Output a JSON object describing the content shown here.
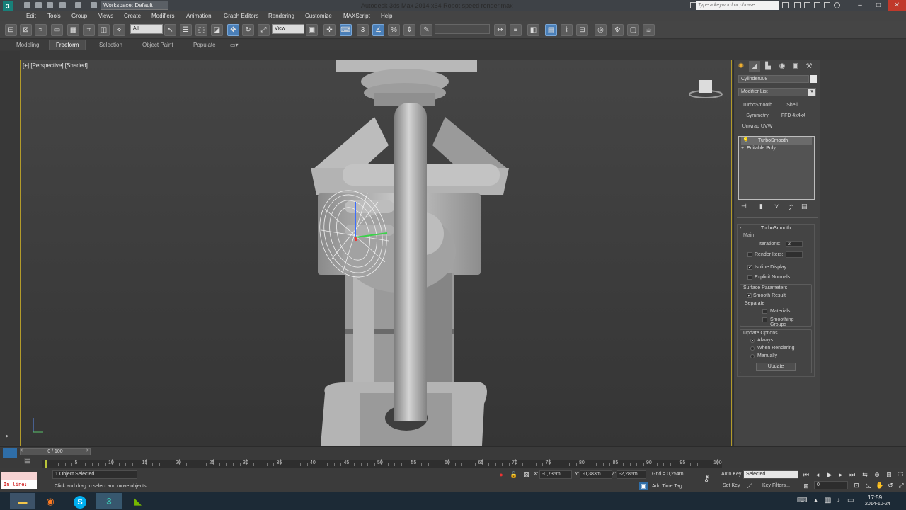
{
  "titlebar": {
    "workspace": "Workspace: Default",
    "app_title": "Autodesk 3ds Max 2014 x64     Robot speed render.max",
    "search_placeholder": "Type a keyword or phrase",
    "min": "–",
    "max": "□",
    "close": "✕"
  },
  "menu": [
    "Edit",
    "Tools",
    "Group",
    "Views",
    "Create",
    "Modifiers",
    "Animation",
    "Graph Editors",
    "Rendering",
    "Customize",
    "MAXScript",
    "Help"
  ],
  "toolbar": {
    "selection_filter": "All",
    "ref_coord": "View",
    "named_sel": ""
  },
  "ribbon": {
    "tabs": [
      "Modeling",
      "Freeform",
      "Selection",
      "Object Paint",
      "Populate"
    ],
    "active": "Freeform"
  },
  "viewport": {
    "label": "[+] [Perspective] [Shaded]"
  },
  "command_panel": {
    "object_name": "Cylinder008",
    "modifier_list": "Modifier List",
    "mod_buttons": [
      "TurboSmooth",
      "Shell",
      "Symmetry",
      "FFD 4x4x4",
      "Unwrap UVW"
    ],
    "stack": [
      "TurboSmooth",
      "Editable Poly"
    ],
    "rollout_title": "TurboSmooth",
    "main_label": "Main",
    "iterations_label": "Iterations:",
    "iterations_value": "2",
    "render_iters_label": "Render Iters:",
    "render_iters_value": "",
    "isoline_display": "Isoline Display",
    "explicit_normals": "Explicit Normals",
    "surface_params": "Surface Parameters",
    "smooth_result": "Smooth Result",
    "separate": "Separate",
    "materials": "Materials",
    "smoothing_groups": "Smoothing Groups",
    "update_options": "Update Options",
    "always": "Always",
    "when_rendering": "When Rendering",
    "manually": "Manually",
    "update_button": "Update"
  },
  "timeline": {
    "slider": "0 / 100",
    "ticks": [
      "0",
      "5",
      "10",
      "15",
      "20",
      "25",
      "30",
      "35",
      "40",
      "45",
      "50",
      "55",
      "60",
      "65",
      "70",
      "75",
      "80",
      "85",
      "90",
      "95",
      "100"
    ]
  },
  "status": {
    "maxscript_listener": "In line:",
    "selected": "1 Object Selected",
    "prompt": "Click and drag to select and move objects",
    "x_label": "X:",
    "x_value": "-0,735m",
    "y_label": "Y:",
    "y_value": "-0,383m",
    "z_label": "Z:",
    "z_value": "-2,286m",
    "grid": "Grid = 0,254m",
    "add_time_tag": "Add Time Tag",
    "auto_key": "Auto Key",
    "set_key": "Set Key",
    "selected_dropdown": "Selected",
    "key_filters": "Key Filters...",
    "frame": "0"
  },
  "taskbar": {
    "time": "17:59",
    "date": "2014-10-24"
  },
  "colors": {
    "viewport_border": "#b39b2a",
    "active_tool": "#4a7fb8",
    "taskbar": "#1c2a36"
  }
}
